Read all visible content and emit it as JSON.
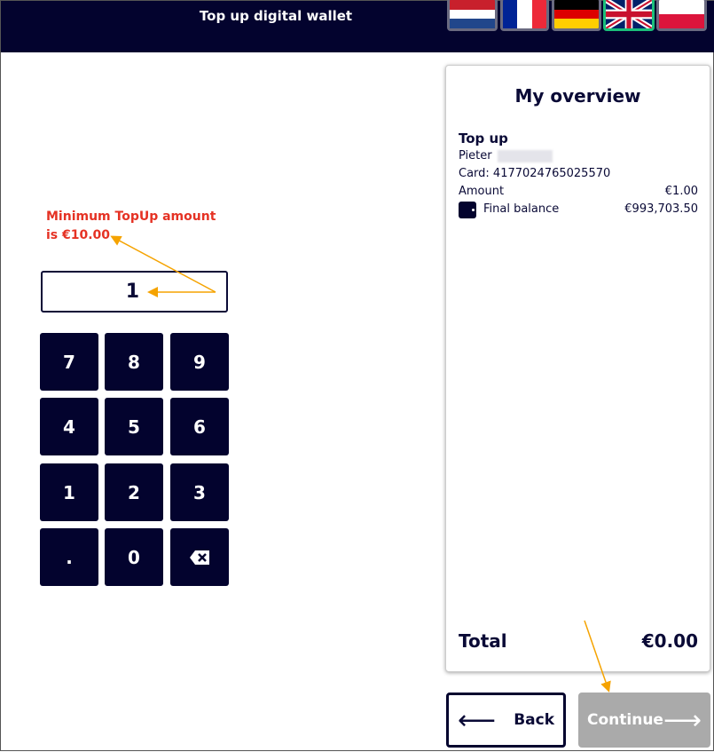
{
  "header": {
    "title": "Top up digital wallet"
  },
  "languages": [
    {
      "name": "Dutch",
      "active": false
    },
    {
      "name": "French",
      "active": false
    },
    {
      "name": "German",
      "active": false
    },
    {
      "name": "English",
      "active": true
    },
    {
      "name": "Polish",
      "active": false
    }
  ],
  "input": {
    "value": "1"
  },
  "keypad": [
    "7",
    "8",
    "9",
    "4",
    "5",
    "6",
    "1",
    "2",
    "3",
    ".",
    "0",
    "backspace-icon"
  ],
  "overview": {
    "title": "My overview",
    "section": "Top up",
    "name": "Pieter",
    "card": "Card: 4177024765025570",
    "amount_label": "Amount",
    "amount_value": "€1.00",
    "balance_label": "Final balance",
    "balance_value": "€993,703.50",
    "total_label": "Total",
    "total_value": "€0.00"
  },
  "buttons": {
    "back": "Back",
    "continue": "Continue"
  },
  "annotation": {
    "line1": "Minimum TopUp amount",
    "line2": "is €10.00",
    "color": "#e53224",
    "arrow_color": "#f5a300"
  }
}
